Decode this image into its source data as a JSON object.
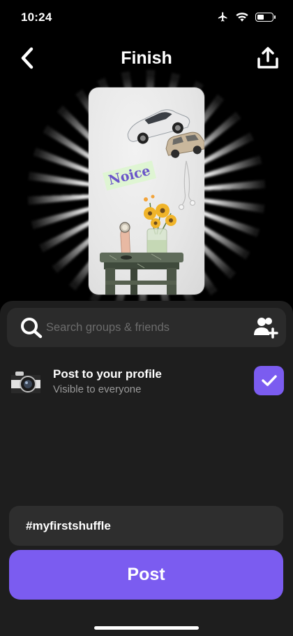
{
  "status_bar": {
    "time": "10:24"
  },
  "nav": {
    "title": "Finish"
  },
  "collage": {
    "sticker_text": "Noice"
  },
  "search": {
    "placeholder": "Search groups & friends"
  },
  "profile_option": {
    "title": "Post to your profile",
    "subtitle": "Visible to everyone",
    "checked": true
  },
  "caption": {
    "value": "#myfirstshuffle"
  },
  "post_button": {
    "label": "Post"
  },
  "colors": {
    "accent": "#7b5cf0",
    "sheet": "#1e1e1e",
    "field": "#2b2b2b"
  },
  "icons": [
    "airplane-icon",
    "wifi-icon",
    "battery-icon",
    "back-chevron-icon",
    "share-upload-icon",
    "search-icon",
    "add-friend-icon",
    "checkmark-icon"
  ]
}
